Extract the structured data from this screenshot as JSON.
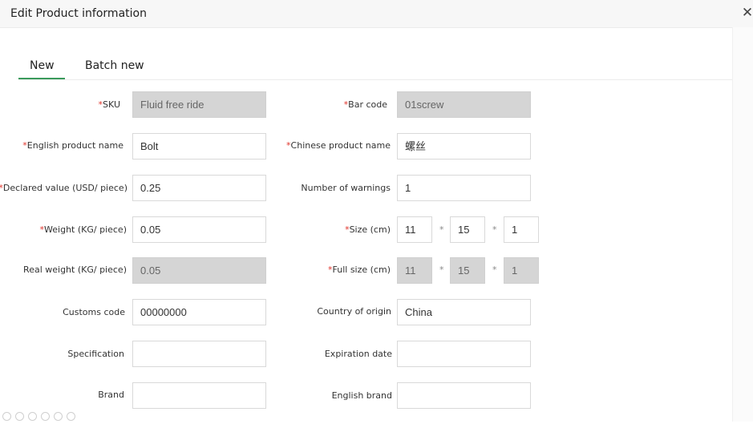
{
  "dialog": {
    "title": "Edit Product information"
  },
  "tabs": [
    {
      "label": "New"
    },
    {
      "label": "Batch new"
    }
  ],
  "form": {
    "sku": {
      "label": "SKU",
      "value": "Fluid free ride"
    },
    "bar_code": {
      "label": "Bar code",
      "value": "01screw"
    },
    "english_product_name": {
      "label": "English product name",
      "value": "Bolt"
    },
    "chinese_product_name": {
      "label": "Chinese product name",
      "value": "螺丝"
    },
    "declared_value": {
      "label": "Declared value (USD/ piece)",
      "value": "0.25"
    },
    "number_of_warnings": {
      "label": "Number of warnings",
      "value": "1"
    },
    "weight": {
      "label": "Weight (KG/ piece)",
      "value": "0.05"
    },
    "size": {
      "label": "Size (cm)",
      "length": "11",
      "width": "15",
      "height": "1"
    },
    "real_weight": {
      "label": "Real weight (KG/ piece)",
      "value": "0.05"
    },
    "full_size": {
      "label": "Full size (cm)",
      "length": "11",
      "width": "15",
      "height": "1"
    },
    "customs_code": {
      "label": "Customs code",
      "value": "00000000"
    },
    "country_of_origin": {
      "label": "Country of origin",
      "value": "China"
    },
    "specification": {
      "label": "Specification",
      "value": ""
    },
    "expiration_date": {
      "label": "Expiration date",
      "value": ""
    },
    "brand": {
      "label": "Brand",
      "value": ""
    },
    "english_brand": {
      "label": "English brand",
      "value": ""
    },
    "required_mark": "*",
    "times_sign": "*"
  }
}
